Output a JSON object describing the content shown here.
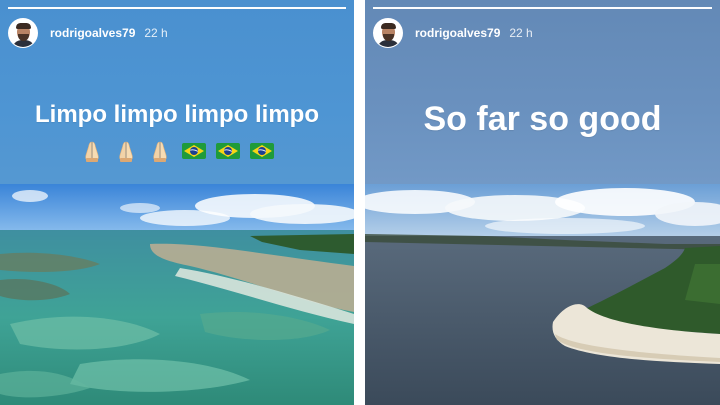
{
  "stories": [
    {
      "username": "rodrigoalves79",
      "time": "22 h",
      "caption": "Limpo limpo limpo limpo",
      "emojis": [
        "folded-hands-icon",
        "folded-hands-icon",
        "folded-hands-icon",
        "brazil-flag-icon",
        "brazil-flag-icon",
        "brazil-flag-icon"
      ],
      "background_color": "#4e95d3",
      "progress": 1.0
    },
    {
      "username": "rodrigoalves79",
      "time": "22 h",
      "caption": "So far so good",
      "background_color": "#6a91bf",
      "progress": 1.0
    }
  ]
}
